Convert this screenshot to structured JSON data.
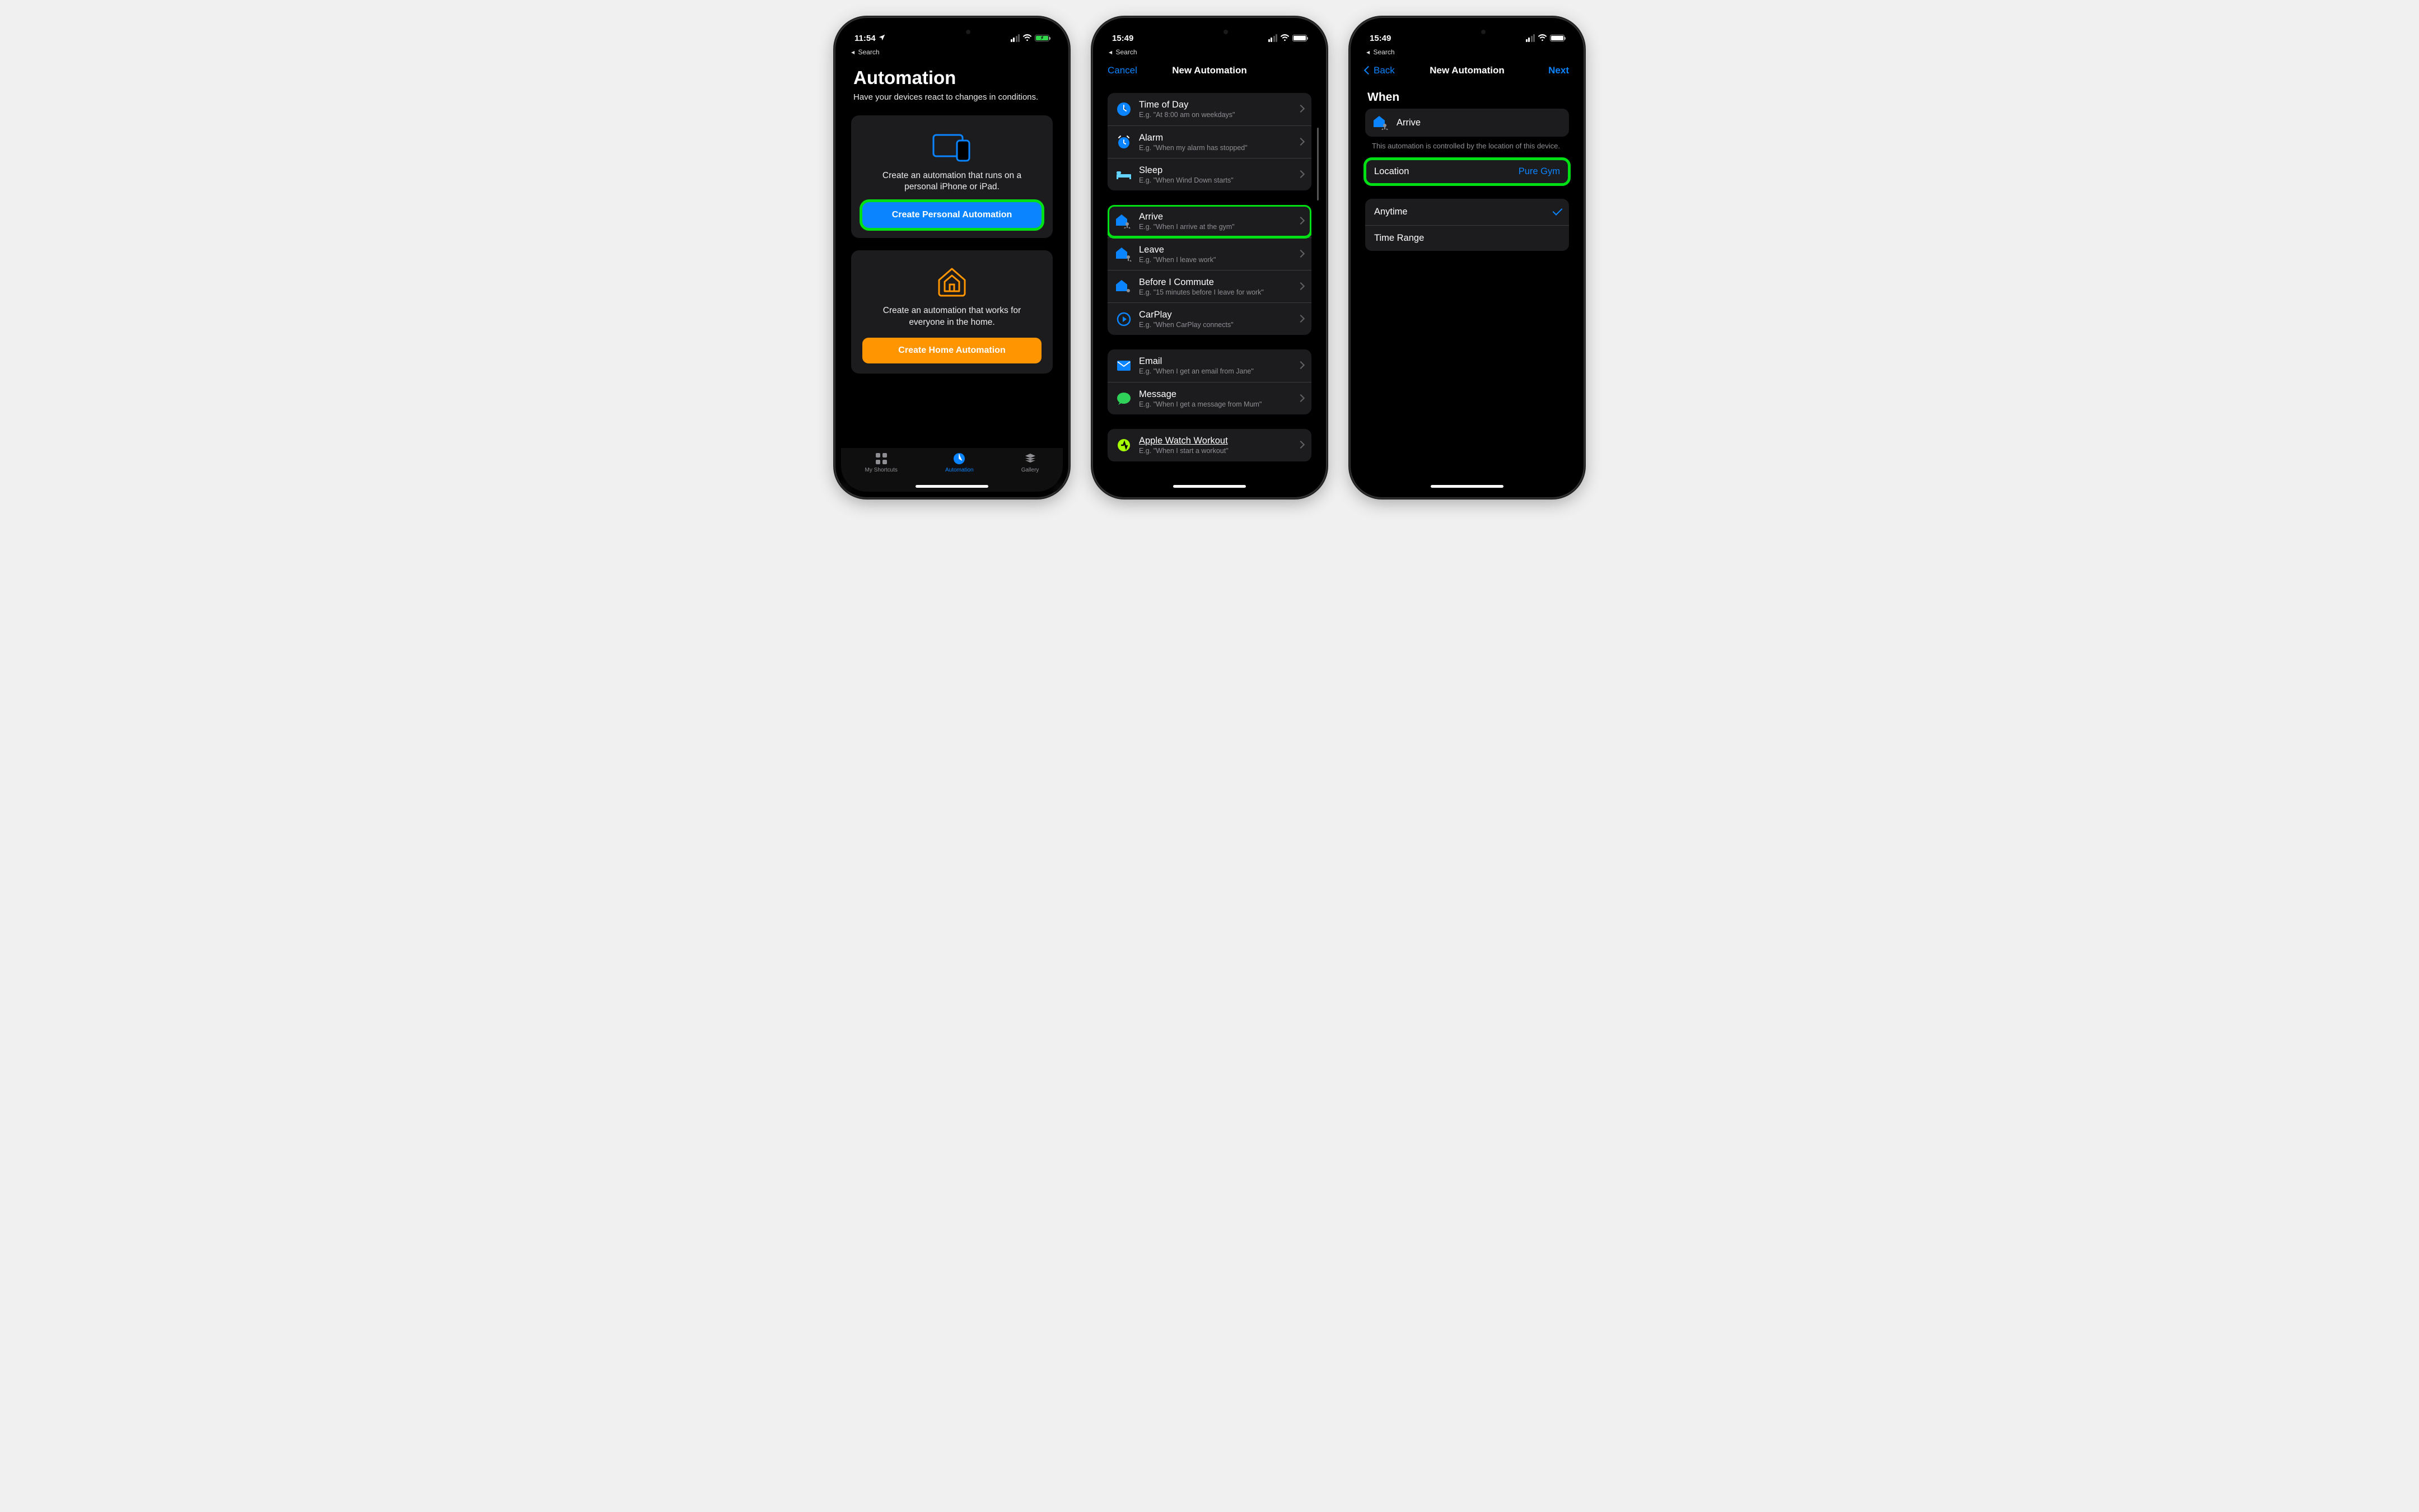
{
  "screen1": {
    "status_time": "11:54",
    "back": "Search",
    "title": "Automation",
    "subtitle": "Have your devices react to changes in conditions.",
    "personal": {
      "desc": "Create an automation that runs on a personal iPhone or iPad.",
      "button": "Create Personal Automation"
    },
    "home": {
      "desc": "Create an automation that works for everyone in the home.",
      "button": "Create Home Automation"
    },
    "tabs": {
      "shortcuts": "My Shortcuts",
      "automation": "Automation",
      "gallery": "Gallery"
    }
  },
  "screen2": {
    "status_time": "15:49",
    "back": "Search",
    "cancel": "Cancel",
    "title": "New Automation",
    "groups": [
      [
        {
          "icon": "clock-icon",
          "title": "Time of Day",
          "sub": "E.g. \"At 8:00 am on weekdays\""
        },
        {
          "icon": "alarm-icon",
          "title": "Alarm",
          "sub": "E.g. \"When my alarm has stopped\""
        },
        {
          "icon": "bed-icon",
          "title": "Sleep",
          "sub": "E.g. \"When Wind Down starts\""
        }
      ],
      [
        {
          "icon": "arrive-icon",
          "title": "Arrive",
          "sub": "E.g. \"When I arrive at the gym\"",
          "highlight": true
        },
        {
          "icon": "leave-icon",
          "title": "Leave",
          "sub": "E.g. \"When I leave work\""
        },
        {
          "icon": "commute-icon",
          "title": "Before I Commute",
          "sub": "E.g. \"15 minutes before I leave for work\""
        },
        {
          "icon": "carplay-icon",
          "title": "CarPlay",
          "sub": "E.g. \"When CarPlay connects\""
        }
      ],
      [
        {
          "icon": "email-icon",
          "title": "Email",
          "sub": "E.g. \"When I get an email from Jane\""
        },
        {
          "icon": "message-icon",
          "title": "Message",
          "sub": "E.g. \"When I get a message from Mum\""
        }
      ],
      [
        {
          "icon": "workout-icon",
          "title": "Apple Watch Workout",
          "sub": "E.g. \"When I start a workout\""
        }
      ]
    ]
  },
  "screen3": {
    "status_time": "15:49",
    "breadcrumb": "Search",
    "back": "Back",
    "title": "New Automation",
    "next": "Next",
    "section": "When",
    "trigger": "Arrive",
    "helper": "This automation is controlled by the location of this device.",
    "location_label": "Location",
    "location_value": "Pure Gym",
    "anytime": "Anytime",
    "timerange": "Time Range"
  }
}
